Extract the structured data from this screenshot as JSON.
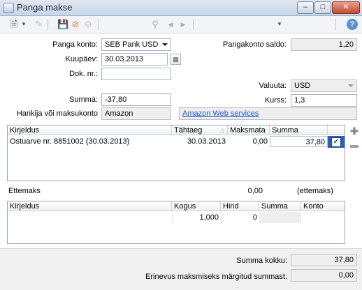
{
  "window": {
    "title": "Panga makse"
  },
  "form": {
    "panga_konto_label": "Panga konto:",
    "panga_konto_value": "SEB Pank USD",
    "kuupaev_label": "Kuupäev:",
    "kuupaev_value": "30.03.2013",
    "dok_nr_label": "Dok. nr.:",
    "dok_nr_value": "",
    "summa_label": "Summa:",
    "summa_value": "-37,80",
    "hankija_label": "Hankija või maksukonto",
    "hankija_value": "Amazon",
    "hankija_link": "Amazon Web services",
    "saldo_label": "Pangakonto saldo:",
    "saldo_value": "1,20",
    "valuuta_label": "Valuuta:",
    "valuuta_value": "USD",
    "kurss_label": "Kurss:",
    "kurss_value": "1,3"
  },
  "invoices": {
    "columns": [
      "Kirjeldus",
      "Tähtaeg",
      "Maksmata",
      "Summa"
    ],
    "rows": [
      {
        "kirjeldus": "Ostuarve nr. 8851002 (30.03.2013)",
        "tahtaeg": "30.03.2013",
        "maksmata": "0,00",
        "summa": "37,80",
        "checked": true
      }
    ]
  },
  "ettemaks": {
    "label": "Ettemaks",
    "value": "0,00",
    "note": "(ettemaks)"
  },
  "prepay_grid": {
    "columns": [
      "Kirjeldus",
      "Kogus",
      "Hind",
      "Summa",
      "Konto"
    ],
    "rows": [
      {
        "kirjeldus": "",
        "kogus": "1,000",
        "hind": "0",
        "summa": "",
        "konto": ""
      }
    ]
  },
  "totals": {
    "summa_kokku_label": "Summa kokku:",
    "summa_kokku_value": "37,80",
    "erinevus_label": "Erinevus maksmiseks märgitud summast:",
    "erinevus_value": "0,00"
  },
  "icons": {
    "minimize": "minimize-icon",
    "maximize": "maximize-icon",
    "close": "close-icon",
    "help": "help-icon",
    "add_row": "plus-icon",
    "remove_row": "minus-icon"
  }
}
